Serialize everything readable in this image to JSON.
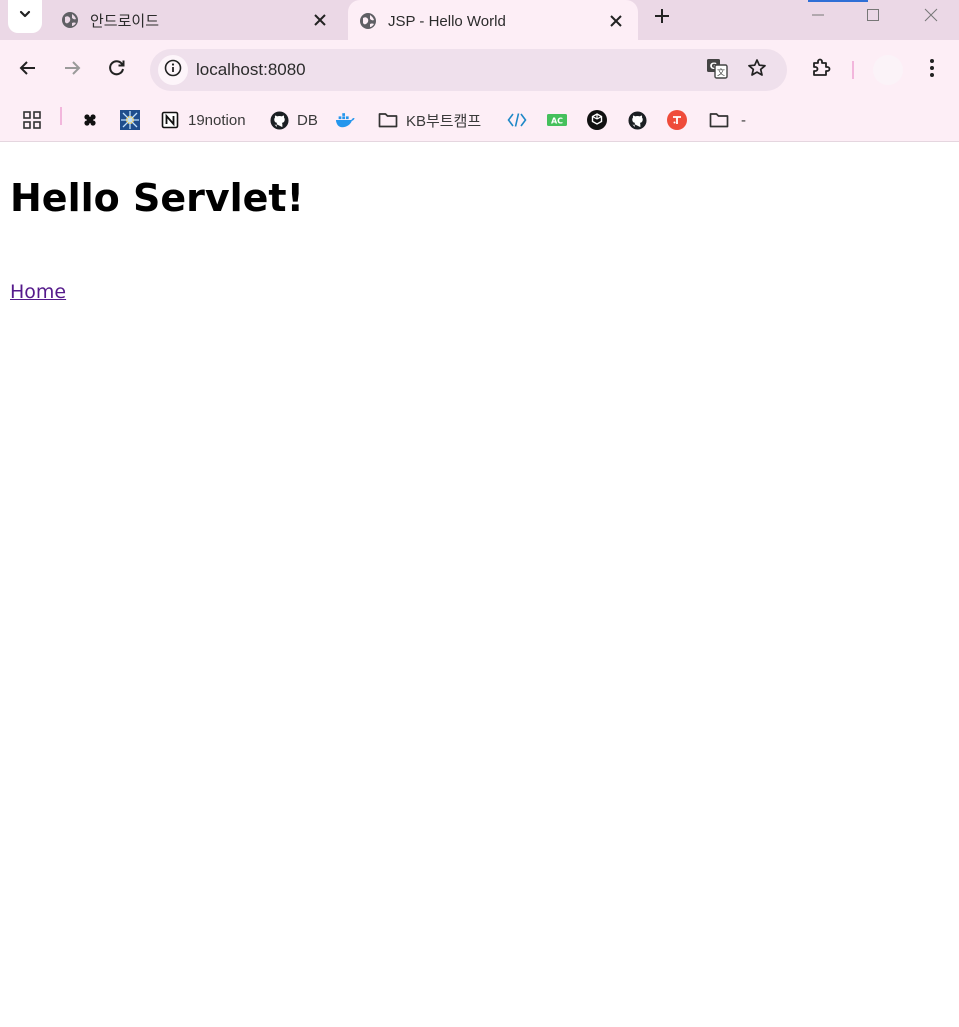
{
  "browser": {
    "tabs": [
      {
        "title": "안드로이드",
        "active": false
      },
      {
        "title": "JSP - Hello World",
        "active": true
      }
    ],
    "omnibox": {
      "url": "localhost:8080"
    },
    "bookmarks": [
      {
        "label": "",
        "icon": "apps-grid-icon"
      },
      {
        "label": "",
        "icon": "figma-icon"
      },
      {
        "label": "",
        "icon": "burst-logo-icon"
      },
      {
        "label": "19notion",
        "icon": "notion-icon"
      },
      {
        "label": "DB",
        "icon": "github-icon"
      },
      {
        "label": "",
        "icon": "docker-icon"
      },
      {
        "label": "KB부트캠프",
        "icon": "folder-icon"
      },
      {
        "label": "",
        "icon": "code-brackets-icon"
      },
      {
        "label": "",
        "icon": "acmicpc-icon"
      },
      {
        "label": "",
        "icon": "openai-icon"
      },
      {
        "label": "",
        "icon": "github-icon"
      },
      {
        "label": "",
        "icon": "red-circle-icon"
      },
      {
        "label": "-",
        "icon": "folder-icon"
      }
    ],
    "colors": {
      "tabstrip": "#ebd8e6",
      "toolbar": "#fdeef6",
      "omnibox": "#efe0ec",
      "visited_link": "#551a8b"
    }
  },
  "page": {
    "heading": "Hello Servlet!",
    "link_text": "Home"
  }
}
